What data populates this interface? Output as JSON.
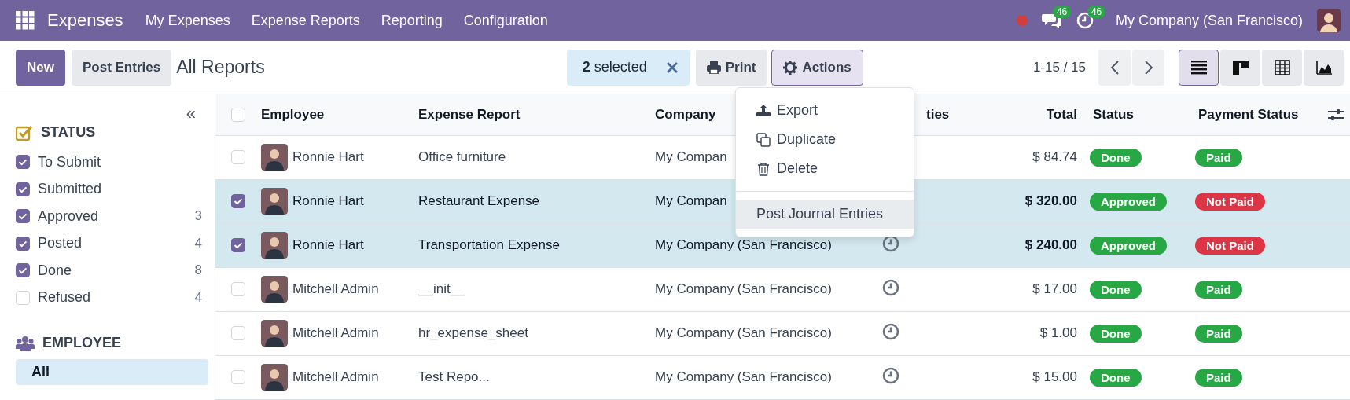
{
  "navbar": {
    "app": "Expenses",
    "menus": [
      "My Expenses",
      "Expense Reports",
      "Reporting",
      "Configuration"
    ],
    "messages_badge": "46",
    "activities_badge": "46",
    "company": "My Company (San Francisco)"
  },
  "control_panel": {
    "new_button": "New",
    "post_button": "Post Entries",
    "breadcrumb": "All Reports",
    "selection": "**2** selected",
    "print_button": "Print",
    "actions_button": {
      "label": "Actions",
      "expanded": true
    },
    "pager": "1-15 / 15",
    "views": [
      {
        "kind": "list",
        "selected": true
      },
      {
        "kind": "kanban",
        "selected": false
      },
      {
        "kind": "pivot",
        "selected": false
      },
      {
        "kind": "graph",
        "selected": false
      }
    ]
  },
  "actions_menu": {
    "items": [
      {
        "kind": "export",
        "label": "Export",
        "highlighted": false
      },
      {
        "kind": "duplicate",
        "label": "Duplicate",
        "highlighted": false
      },
      {
        "kind": "delete",
        "label": "Delete",
        "highlighted": false
      },
      {
        "kind": "separator"
      },
      {
        "kind": "plain",
        "label": "Post Journal Entries",
        "highlighted": true
      }
    ]
  },
  "sidebar": {
    "collapse_button": "«",
    "sections": [
      {
        "kind": "status",
        "title": "STATUS",
        "items": [
          {
            "label": "To Submit",
            "checked": true
          },
          {
            "label": "Submitted",
            "checked": true
          },
          {
            "label": "Approved",
            "count": "3",
            "checked": true
          },
          {
            "label": "Posted",
            "count": "4",
            "checked": true
          },
          {
            "label": "Done",
            "count": "8",
            "checked": true
          },
          {
            "label": "Refused",
            "count": "4",
            "checked": false
          }
        ]
      },
      {
        "kind": "employee",
        "title": "EMPLOYEE",
        "items": [
          {
            "label": "All",
            "selected": true
          }
        ]
      }
    ]
  },
  "table": {
    "select_all_checked": false,
    "columns": [
      "Employee",
      "Expense Report",
      "Company",
      "ties",
      "Total",
      "Status",
      "Payment Status"
    ],
    "rows": [
      {
        "selected": false,
        "employee": "Ronnie Hart",
        "report": "Office furniture",
        "company": "My Compan",
        "total": "$ 84.74",
        "status": {
          "label": "Done",
          "color": "#28a745"
        },
        "payment": {
          "label": "Paid",
          "color": "#28a745"
        }
      },
      {
        "selected": true,
        "employee": "Ronnie Hart",
        "report": "Restaurant Expense",
        "company": "My Compan",
        "total": "$ 320.00",
        "status": {
          "label": "Approved",
          "color": "#28a745"
        },
        "payment": {
          "label": "Not Paid",
          "color": "#dc3545"
        }
      },
      {
        "selected": true,
        "employee": "Ronnie Hart",
        "report": "Transportation Expense",
        "company": "My Company (San Francisco)",
        "activity": true,
        "total": "$ 240.00",
        "status": {
          "label": "Approved",
          "color": "#28a745"
        },
        "payment": {
          "label": "Not Paid",
          "color": "#dc3545"
        }
      },
      {
        "selected": false,
        "employee": "Mitchell Admin",
        "report": "__init__",
        "company": "My Company (San Francisco)",
        "activity": true,
        "total": "$ 17.00",
        "status": {
          "label": "Done",
          "color": "#28a745"
        },
        "payment": {
          "label": "Paid",
          "color": "#28a745"
        }
      },
      {
        "selected": false,
        "employee": "Mitchell Admin",
        "report": "hr_expense_sheet",
        "company": "My Company (San Francisco)",
        "activity": true,
        "total": "$ 1.00",
        "status": {
          "label": "Done",
          "color": "#28a745"
        },
        "payment": {
          "label": "Paid",
          "color": "#28a745"
        }
      },
      {
        "selected": false,
        "employee": "Mitchell Admin",
        "report": "Test Repo...",
        "company": "My Company (San Francisco)",
        "activity": true,
        "total": "$ 15.00",
        "status": {
          "label": "Done",
          "color": "#28a745"
        },
        "payment": {
          "label": "Paid",
          "color": "#28a745"
        }
      }
    ]
  }
}
